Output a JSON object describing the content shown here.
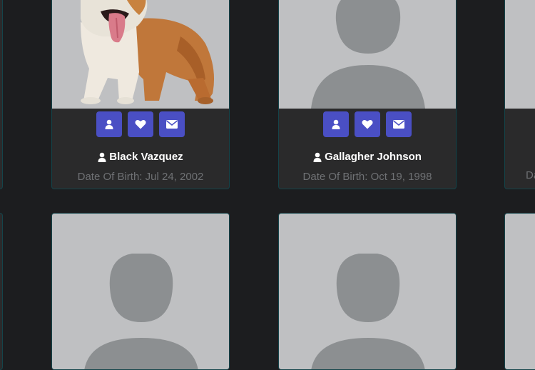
{
  "cards": [
    {
      "name": "Black Vazquez",
      "dob": "Date Of Birth: Jul 24, 2002",
      "photo": "bulldog-photo",
      "buttons": [
        "profile-icon",
        "heart-icon",
        "mail-icon"
      ]
    },
    {
      "name": "Gallagher Johnson",
      "dob": "Date Of Birth: Oct 19, 1998",
      "photo": "avatar-placeholder",
      "buttons": [
        "profile-icon",
        "heart-icon",
        "mail-icon"
      ]
    },
    {
      "photo": "avatar-placeholder"
    },
    {
      "photo": "avatar-placeholder"
    }
  ],
  "partial_right_card": {
    "dob_fragment": "Da"
  },
  "colors": {
    "background": "#1c1d1f",
    "card": "#2a2a2b",
    "card_border": "#14444a",
    "photo_bg": "#bfc0c2",
    "placeholder": "#8c8f91",
    "button": "#4a4fc4",
    "name": "#ffffff",
    "dob": "#6f7174"
  }
}
